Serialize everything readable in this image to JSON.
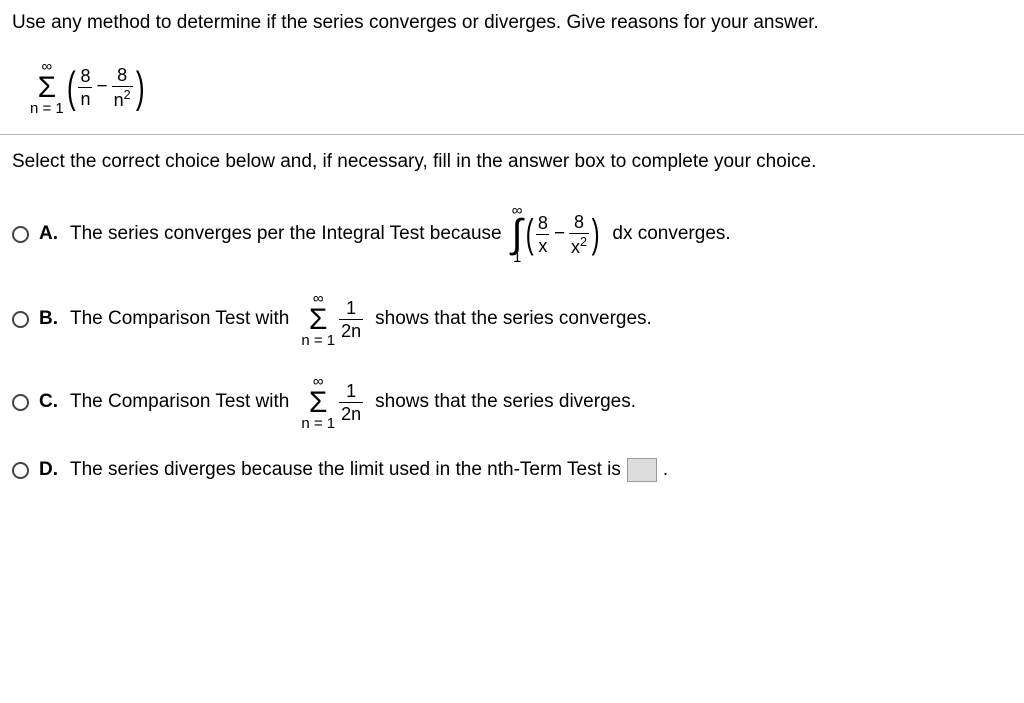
{
  "prompt": "Use any method to determine if the series converges or diverges. Give reasons for your answer.",
  "series": {
    "top": "∞",
    "bottom": "n = 1",
    "term": {
      "frac1_num": "8",
      "frac1_den": "n",
      "frac2_num": "8",
      "frac2_den_base": "n",
      "frac2_den_exp": "2"
    }
  },
  "instruction": "Select the correct choice below and, if necessary, fill in the answer box to complete your choice.",
  "choices": {
    "A": {
      "letter": "A.",
      "pre": "The series converges per the Integral Test because",
      "post": "dx converges.",
      "int_top": "∞",
      "int_bot": "1",
      "f1n": "8",
      "f1d": "x",
      "f2n": "8",
      "f2d_base": "x",
      "f2d_exp": "2"
    },
    "B": {
      "letter": "B.",
      "pre": "The Comparison Test with",
      "post": "shows that the series converges.",
      "sum_top": "∞",
      "sum_bot": "n = 1",
      "fn": "1",
      "fd": "2n"
    },
    "C": {
      "letter": "C.",
      "pre": "The Comparison Test with",
      "post": "shows that the series diverges.",
      "sum_top": "∞",
      "sum_bot": "n = 1",
      "fn": "1",
      "fd": "2n"
    },
    "D": {
      "letter": "D.",
      "text_pre": "The series diverges because the limit used in the nth-Term Test is",
      "text_post": "."
    }
  }
}
